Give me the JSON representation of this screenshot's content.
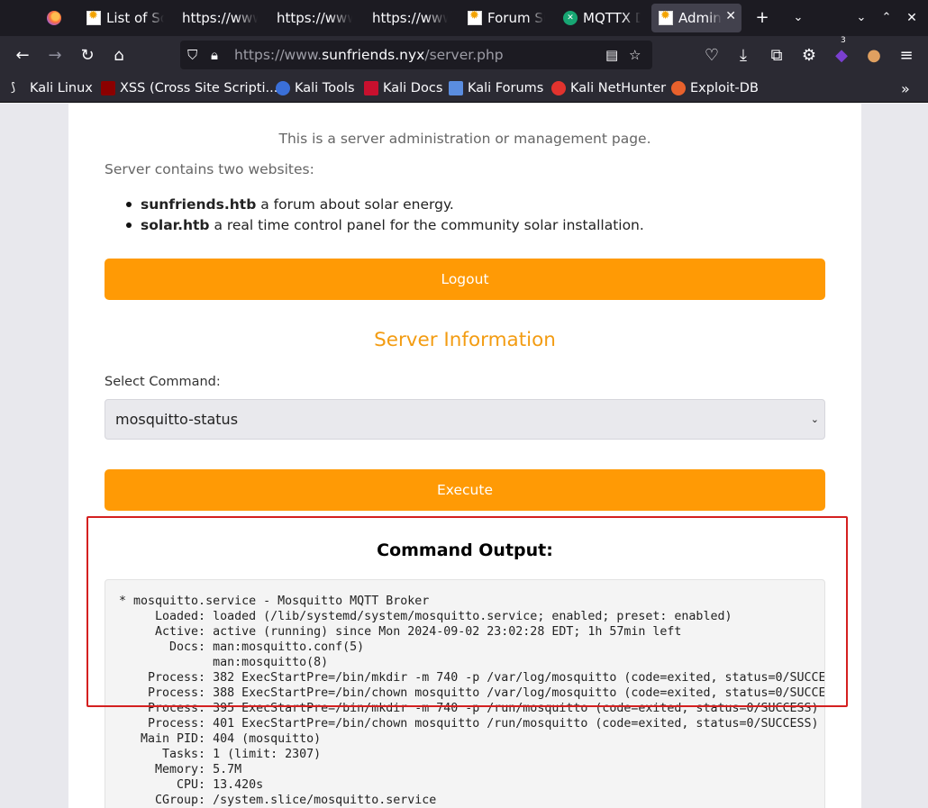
{
  "browser": {
    "tabs": [
      {
        "label": "",
        "favicon": "firefox-icon"
      },
      {
        "label": "List of Sol",
        "favicon": "sun-icon"
      },
      {
        "label": "https://www.",
        "favicon": ""
      },
      {
        "label": "https://www.",
        "favicon": ""
      },
      {
        "label": "https://www.",
        "favicon": ""
      },
      {
        "label": "Forum Sun",
        "favicon": "sun-icon"
      },
      {
        "label": "MQTTX Des",
        "favicon": "mqttx-icon"
      },
      {
        "label": "Admin",
        "favicon": "sun-icon",
        "active": true
      }
    ],
    "new_tab": "+",
    "url": {
      "scheme": "https://www.",
      "host": "sunfriends.nyx",
      "path": "/server.php"
    },
    "extension_badge": "3",
    "bookmarks": [
      {
        "label": "Kali Linux",
        "icon": "kali-dragon-icon"
      },
      {
        "label": "XSS (Cross Site Scripti...",
        "icon": "xss-icon"
      },
      {
        "label": "Kali Tools",
        "icon": "kali-tools-icon"
      },
      {
        "label": "Kali Docs",
        "icon": "kali-docs-icon"
      },
      {
        "label": "Kali Forums",
        "icon": "kali-forums-icon"
      },
      {
        "label": "Kali NetHunter",
        "icon": "nethunter-icon"
      },
      {
        "label": "Exploit-DB",
        "icon": "exploit-db-icon"
      }
    ]
  },
  "page": {
    "intro": "This is a server administration or management page.",
    "para": "Server contains two websites:",
    "sites": [
      {
        "name": "sunfriends.htb",
        "desc": " a forum about solar energy."
      },
      {
        "name": "solar.htb",
        "desc": " a real time control panel for the community solar installation."
      }
    ],
    "logout_label": "Logout",
    "section_title": "Server Information",
    "select_label": "Select Command:",
    "selected_command": "mosquitto-status",
    "execute_label": "Execute",
    "output_title": "Command Output:",
    "output_lines": [
      "* mosquitto.service - Mosquitto MQTT Broker",
      "     Loaded: loaded (/lib/systemd/system/mosquitto.service; enabled; preset: enabled)",
      "     Active: active (running) since Mon 2024-09-02 23:02:28 EDT; 1h 57min left",
      "       Docs: man:mosquitto.conf(5)",
      "             man:mosquitto(8)",
      "    Process: 382 ExecStartPre=/bin/mkdir -m 740 -p /var/log/mosquitto (code=exited, status=0/SUCCE",
      "    Process: 388 ExecStartPre=/bin/chown mosquitto /var/log/mosquitto (code=exited, status=0/SUCCE",
      "    Process: 395 ExecStartPre=/bin/mkdir -m 740 -p /run/mosquitto (code=exited, status=0/SUCCESS)",
      "    Process: 401 ExecStartPre=/bin/chown mosquitto /run/mosquitto (code=exited, status=0/SUCCESS)",
      "   Main PID: 404 (mosquitto)",
      "      Tasks: 1 (limit: 2307)",
      "     Memory: 5.7M",
      "        CPU: 13.420s",
      "     CGroup: /system.slice/mosquitto.service"
    ],
    "accent_color": "#ff9a05",
    "highlight_color": "#d42020"
  }
}
